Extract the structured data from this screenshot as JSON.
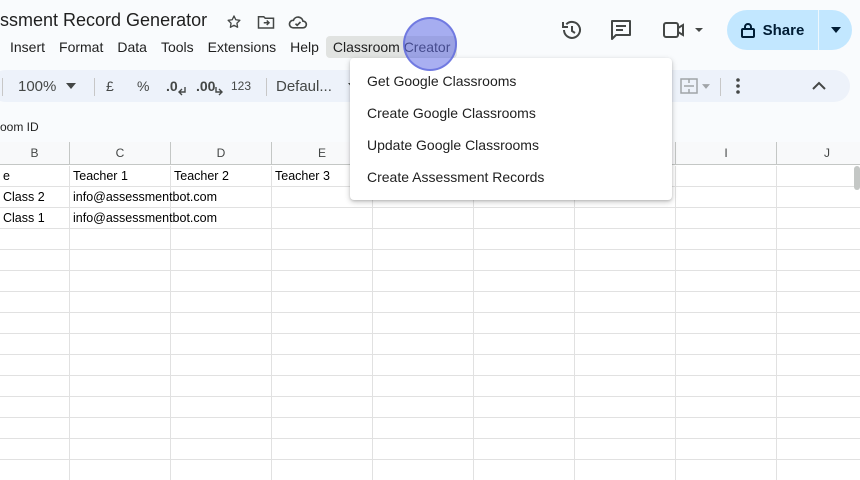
{
  "header": {
    "title": "ssment Record Generator",
    "share_label": "Share"
  },
  "menubar": {
    "items": [
      "Insert",
      "Format",
      "Data",
      "Tools",
      "Extensions",
      "Help",
      "Classroom Creator"
    ]
  },
  "toolbar": {
    "zoom": "100%",
    "currency": "£",
    "percent": "%",
    "decrease_decimal": ".0",
    "increase_decimal": ".00",
    "number_format": "123",
    "font": "Defaul..."
  },
  "formula_bar": {
    "name_box": "oom ID"
  },
  "columns": [
    "B",
    "C",
    "D",
    "E",
    "I",
    "J"
  ],
  "rows": [
    {
      "b": "e",
      "c": "Teacher 1",
      "d": "Teacher 2",
      "e": "Teacher 3"
    },
    {
      "b": "Class 2",
      "c": "info@assessmentbot.com",
      "d": "",
      "e": ""
    },
    {
      "b": "Class 1",
      "c": "info@assessmentbot.com",
      "d": "",
      "e": ""
    }
  ],
  "dropdown": {
    "items": [
      "Get Google Classrooms",
      "Create Google Classrooms",
      "Update Google Classrooms",
      "Create Assessment Records"
    ]
  },
  "colors": {
    "share_bg": "#c2e7ff",
    "toolbar_bg": "#edf2fa",
    "page_bg": "#f9fbfd",
    "cursor": "#636ee6"
  }
}
